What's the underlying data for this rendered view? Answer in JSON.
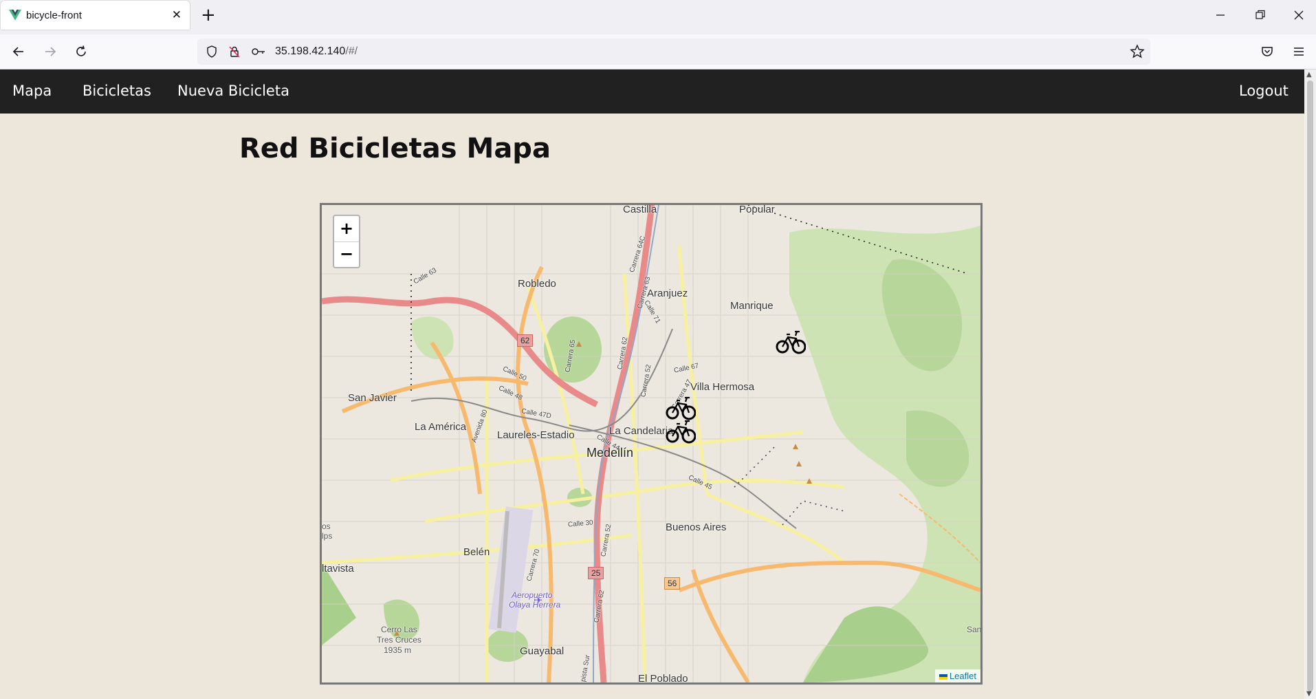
{
  "browser": {
    "tab_title": "bicycle-front",
    "new_tab_label": "+",
    "close_tab_label": "✕",
    "url_host": "35.198.42.140",
    "url_path": "/#/"
  },
  "app_nav": {
    "items": [
      {
        "label": "Mapa"
      },
      {
        "label": "Bicicletas"
      },
      {
        "label": "Nueva Bicicleta"
      }
    ],
    "logout_label": "Logout"
  },
  "page": {
    "title": "Red Bicicletas Mapa"
  },
  "map": {
    "zoom_in_label": "+",
    "zoom_out_label": "−",
    "attribution": "Leaflet",
    "place_labels": {
      "castilla": "Castilla",
      "popular": "Popular",
      "robledo": "Robledo",
      "aranjuez": "Aranjuez",
      "manrique": "Manrique",
      "san_javier": "San Javier",
      "villa_hermosa": "Villa Hermosa",
      "la_america": "La América",
      "laureles": "Laureles-Estadio",
      "la_candelaria": "La Candelaria",
      "medellin": "Medellín",
      "buenos_aires": "Buenos Aires",
      "belen": "Belén",
      "altavista": "ltavista",
      "cerro": "Cerro Las",
      "cerro2": "Tres Cruces",
      "cerro3": "1935 m",
      "guayabal": "Guayabal",
      "el_poblado": "El Poblado",
      "san_edge": "San",
      "os_edge": "os",
      "lps_edge": "lps",
      "aeropuerto": "Aeropuerto",
      "aeropuerto2": "Olaya Herrera"
    },
    "road_labels": {
      "calle63": "Calle 63",
      "carrera64c": "Carrera 64C",
      "carrera63": "Carrera 63",
      "calle71": "Calle 71",
      "carrera65": "Carrera 65",
      "carrera62": "Carrera 62",
      "carrera52": "Carrera 52",
      "calle67": "Calle 67",
      "calle50": "Calle 50",
      "calle48": "Calle 48",
      "calle47d": "Calle 47D",
      "carrera47": "Carrera 47",
      "avenida80": "Avenida 80",
      "calle44": "Calle 44",
      "calle45": "Calle 45",
      "calle30": "Calle 30",
      "carrera70": "Carrera 70",
      "carrera52b": "Carrera 52",
      "carrera62b": "Carrera 62",
      "sur": "Sur",
      "sur2": "pista Sur"
    },
    "shields": {
      "r62": "62",
      "r25": "25",
      "r56": "56"
    },
    "markers": [
      {
        "name": "bicycle-marker-1",
        "icon": "bicycle-icon"
      },
      {
        "name": "bicycle-marker-2",
        "icon": "bicycle-icon"
      },
      {
        "name": "bicycle-marker-3",
        "icon": "bicycle-icon"
      }
    ]
  }
}
